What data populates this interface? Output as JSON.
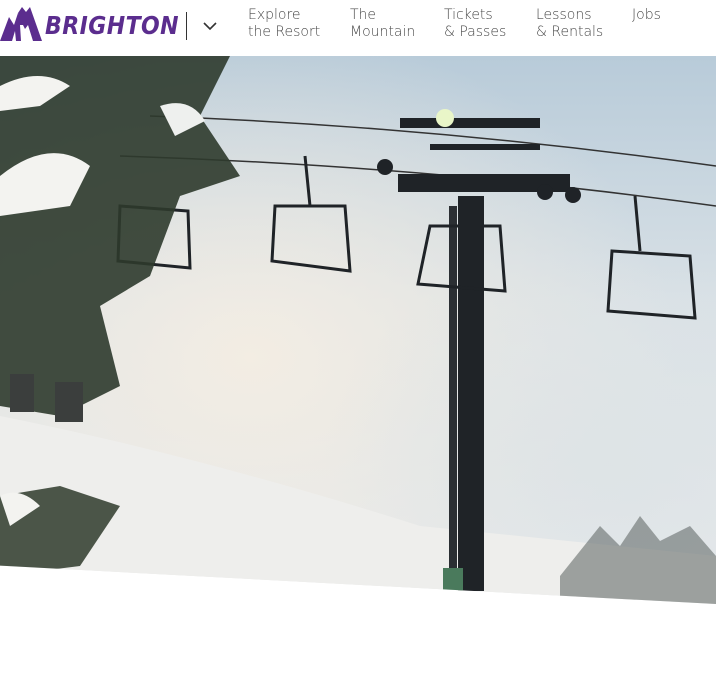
{
  "brand": {
    "name": "BRIGHTON",
    "color": "#5b2d8e"
  },
  "nav": {
    "items": [
      {
        "line1": "Explore",
        "line2": "the Resort"
      },
      {
        "line1": "The",
        "line2": "Mountain"
      },
      {
        "line1": "Tickets",
        "line2": "& Passes"
      },
      {
        "line1": "Lessons",
        "line2": "& Rentals"
      },
      {
        "line1": "Jobs",
        "line2": ""
      }
    ],
    "menu_icon": "chevron-down-icon"
  },
  "hero": {
    "icon": "ski-lift-photo"
  }
}
